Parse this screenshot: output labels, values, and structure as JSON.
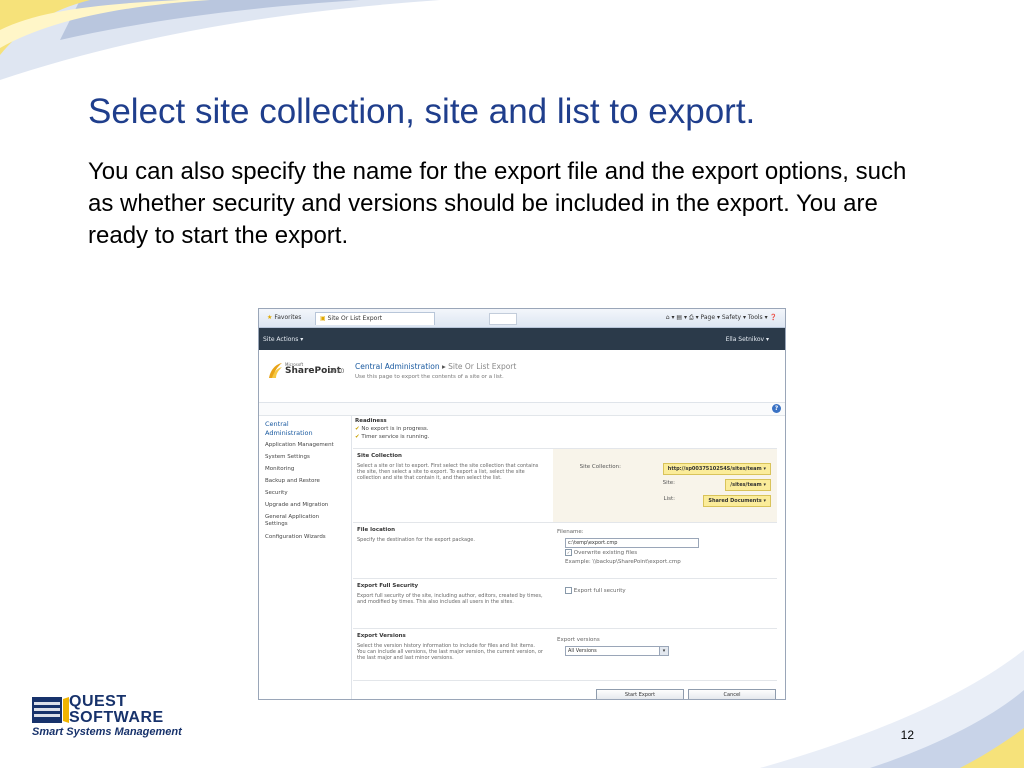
{
  "slide": {
    "title": "Select site collection, site and list to export.",
    "body": "You can also specify the name for the export file and the export options, such as whether security and versions should be included in the export. You are ready to start the export.",
    "page_number": "12"
  },
  "logo": {
    "line1": "QUEST",
    "line2": "SOFTWARE",
    "tagline": "Smart Systems Management"
  },
  "browser": {
    "favorites": "Favorites",
    "tab_title": "Site Or List Export",
    "tools": "Page ▾  Safety ▾  Tools ▾"
  },
  "sharepoint": {
    "site_actions": "Site Actions ▾",
    "user": "Ella Setnikov ▾",
    "logo_ms": "Microsoft",
    "logo_name": "SharePoint",
    "logo_version": "2010",
    "breadcrumb_root": "Central Administration",
    "breadcrumb_sep": "▸",
    "breadcrumb_current": "Site Or List Export",
    "subtitle": "Use this page to export the contents of a site or a list.",
    "quick_launch": [
      "Central Administration",
      "Application Management",
      "System Settings",
      "Monitoring",
      "Backup and Restore",
      "Security",
      "Upgrade and Migration",
      "General Application Settings",
      "Configuration Wizards"
    ],
    "readiness": {
      "title": "Readiness",
      "items": [
        "No export is in progress.",
        "Timer service is running."
      ]
    },
    "site_collection": {
      "heading": "Site Collection",
      "description": "Select a site or list to export.  First select the site collection that contains the site, then select a site to export. To export a list, select the site collection and site that contain it, and then select the list.",
      "site_collection_label": "Site Collection:",
      "site_collection_value": "http://sp0037510254S/sites/team ▾",
      "site_label": "Site:",
      "site_value": "/sites/team ▾",
      "list_label": "List:",
      "list_value": "Shared Documents ▾"
    },
    "file_location": {
      "heading": "File location",
      "description": "Specify the destination for the export package.",
      "filename_label": "Filename:",
      "filename_value": "c:\\temp\\export.cmp",
      "overwrite_label": "Overwrite existing files",
      "example": "Example: \\\\backup\\SharePoint\\export.cmp"
    },
    "export_security": {
      "heading": "Export Full Security",
      "description": "Export full security of the site, including author, editors, created by times, and modified by times. This also includes all users in the sites.",
      "checkbox_label": "Export full security"
    },
    "export_versions": {
      "heading": "Export Versions",
      "description": "Select the version history information to include for files and list items. You can include all versions, the last major version, the current version, or the last major and last minor versions.",
      "dropdown_label": "Export versions",
      "dropdown_value": "All Versions"
    },
    "buttons": {
      "start": "Start Export",
      "cancel": "Cancel"
    }
  }
}
